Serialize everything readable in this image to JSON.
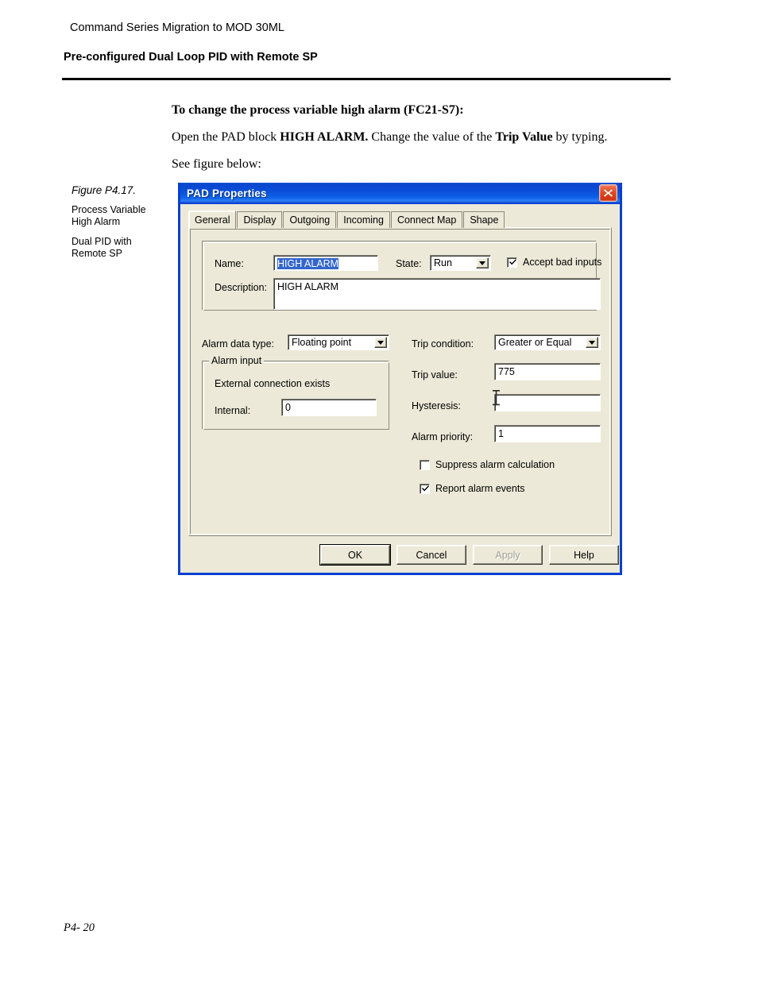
{
  "page": {
    "running_head": "Command Series Migration to MOD 30ML",
    "section_head": "Pre-configured Dual Loop PID with Remote SP",
    "heading": "To change the process variable high alarm (FC21-S7):",
    "para_1_a": "Open the PAD block ",
    "para_1_b": "HIGH ALARM.",
    "para_1_c": " Change the value of the ",
    "para_1_d": "Trip Value",
    "para_1_e": " by typing.",
    "para_2": "See figure below:",
    "footer": "P4- 20"
  },
  "figure": {
    "number": "Figure P4.17.",
    "line1": "Process Variable High Alarm",
    "line2": "Dual PID with Remote SP"
  },
  "dialog": {
    "title": "PAD Properties",
    "close_icon": "close-icon",
    "tabs": [
      {
        "label": "General",
        "active": true
      },
      {
        "label": "Display",
        "active": false
      },
      {
        "label": "Outgoing",
        "active": false
      },
      {
        "label": "Incoming",
        "active": false
      },
      {
        "label": "Connect Map",
        "active": false
      },
      {
        "label": "Shape",
        "active": false
      }
    ],
    "general": {
      "name_label": "Name:",
      "name_value": "HIGH ALARM",
      "state_label": "State:",
      "state_value": "Run",
      "accept_bad_inputs_label": "Accept bad inputs",
      "accept_bad_inputs_checked": true,
      "description_label": "Description:",
      "description_value": "HIGH ALARM",
      "alarm_data_type_label": "Alarm data type:",
      "alarm_data_type_value": "Floating point",
      "alarm_input_group_title": "Alarm input",
      "external_connection_text": "External connection exists",
      "internal_label": "Internal:",
      "internal_value": "0",
      "trip_condition_label": "Trip condition:",
      "trip_condition_value": "Greater or Equal",
      "trip_value_label": "Trip value:",
      "trip_value_value": "775",
      "hysteresis_label": "Hysteresis:",
      "hysteresis_value": "",
      "alarm_priority_label": "Alarm priority:",
      "alarm_priority_value": "1",
      "suppress_alarm_label": "Suppress alarm calculation",
      "suppress_alarm_checked": false,
      "report_alarm_label": "Report alarm events",
      "report_alarm_checked": true
    },
    "buttons": {
      "ok": "OK",
      "cancel": "Cancel",
      "apply": "Apply",
      "help": "Help"
    },
    "colors": {
      "titlebar_blue": "#0b4ed8",
      "frame_blue": "#0a3fd1",
      "face": "#ece9d8",
      "close_red": "#c8340f",
      "selection_blue": "#3366cc"
    }
  }
}
